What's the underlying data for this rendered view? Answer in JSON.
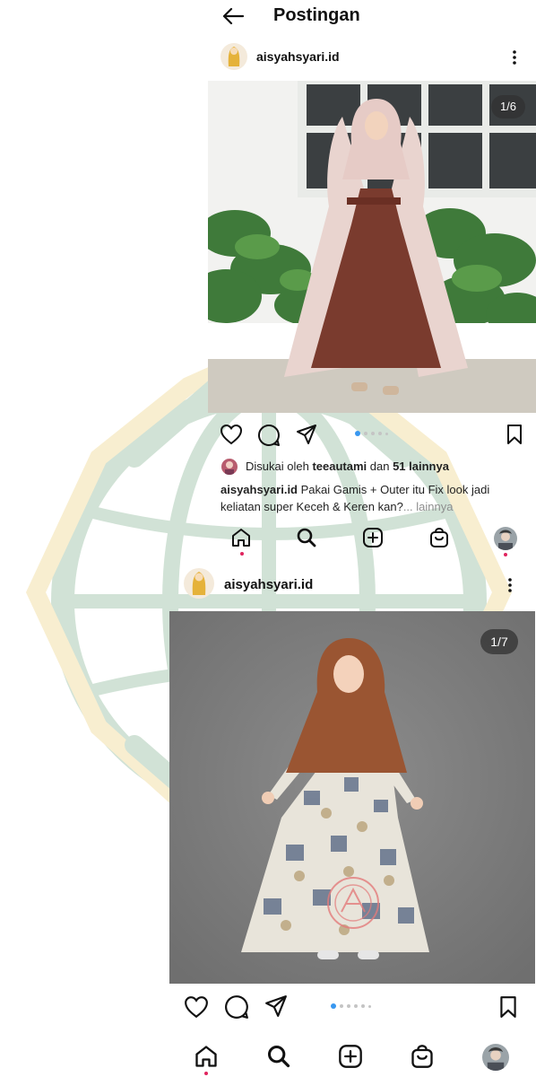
{
  "header": {
    "title": "Postingan"
  },
  "post1": {
    "username": "aisyahsyari.id",
    "counter": "1/6",
    "likes_prefix": "Disukai oleh ",
    "likes_user": "teeautami",
    "likes_mid": " dan ",
    "likes_count": "51 lainnya",
    "caption_user": "aisyahsyari.id",
    "caption_text": " Pakai Gamis + Outer itu Fix look jadi keliatan super Keceh & Keren kan?",
    "caption_more": "... lainnya"
  },
  "post2": {
    "username": "aisyahsyari.id",
    "counter": "1/7"
  },
  "colors": {
    "accent_blue": "#3897f0",
    "watermark_green": "#5e9b6e",
    "watermark_gold": "#e8c45a",
    "dress_brown": "#7a3b2e",
    "hijab_brown": "#9a5532",
    "backdrop_gray": "#808080"
  },
  "icons": {
    "back": "arrow-left-icon",
    "more": "more-vertical-icon",
    "like": "heart-icon",
    "comment": "comment-icon",
    "share": "send-icon",
    "save": "bookmark-icon",
    "home": "home-icon",
    "search": "search-icon",
    "create": "plus-square-icon",
    "shop": "shopping-bag-icon"
  }
}
